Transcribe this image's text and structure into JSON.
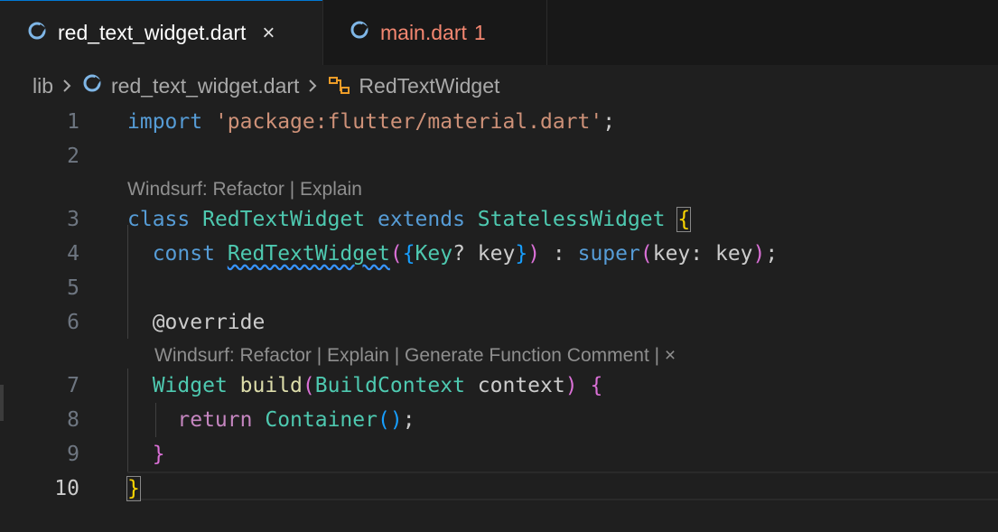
{
  "tabs": [
    {
      "label": "red_text_widget.dart",
      "icon": "dart-file-icon",
      "active": true,
      "close": "×"
    },
    {
      "label": "main.dart",
      "badge": "1",
      "icon": "dart-file-icon",
      "active": false
    }
  ],
  "breadcrumb": {
    "folder": "lib",
    "file": "red_text_widget.dart",
    "symbol": "RedTextWidget",
    "separator_icon": "chevron-right-icon",
    "symbol_icon": "class-symbol-icon"
  },
  "codelens": {
    "class_lens": "Windsurf: Refactor | Explain",
    "method_lens": "Windsurf: Refactor | Explain | Generate Function Comment | ×"
  },
  "lines": [
    {
      "num": "1",
      "tokens": [
        {
          "t": "import",
          "c": "k"
        },
        {
          "t": " "
        },
        {
          "t": "'package:flutter/material.dart'",
          "c": "s"
        },
        {
          "t": ";",
          "c": "p"
        }
      ]
    },
    {
      "num": "2",
      "tokens": []
    },
    {
      "num": "3",
      "tokens": [
        {
          "t": "class",
          "c": "k"
        },
        {
          "t": " "
        },
        {
          "t": "RedTextWidget",
          "c": "t"
        },
        {
          "t": " "
        },
        {
          "t": "extends",
          "c": "k"
        },
        {
          "t": " "
        },
        {
          "t": "StatelessWidget",
          "c": "t"
        },
        {
          "t": " "
        },
        {
          "t": "{",
          "c": "b1 bm"
        }
      ]
    },
    {
      "num": "4",
      "tokens": [
        {
          "t": "  "
        },
        {
          "t": "const",
          "c": "k"
        },
        {
          "t": " "
        },
        {
          "t": "RedTextWidget",
          "c": "t squig"
        },
        {
          "t": "(",
          "c": "b2"
        },
        {
          "t": "{",
          "c": "b3"
        },
        {
          "t": "Key",
          "c": "t"
        },
        {
          "t": "? ",
          "c": "p"
        },
        {
          "t": "key",
          "c": "p"
        },
        {
          "t": "}",
          "c": "b3"
        },
        {
          "t": ")",
          "c": "b2"
        },
        {
          "t": " : ",
          "c": "p"
        },
        {
          "t": "super",
          "c": "k"
        },
        {
          "t": "(",
          "c": "b2"
        },
        {
          "t": "key",
          "c": "p"
        },
        {
          "t": ": ",
          "c": "p"
        },
        {
          "t": "key",
          "c": "p"
        },
        {
          "t": ")",
          "c": "b2"
        },
        {
          "t": ";",
          "c": "p"
        }
      ]
    },
    {
      "num": "5",
      "tokens": []
    },
    {
      "num": "6",
      "tokens": [
        {
          "t": "  "
        },
        {
          "t": "@override",
          "c": "p"
        }
      ]
    },
    {
      "num": "7",
      "tokens": [
        {
          "t": "  "
        },
        {
          "t": "Widget",
          "c": "t"
        },
        {
          "t": " "
        },
        {
          "t": "build",
          "c": "f"
        },
        {
          "t": "(",
          "c": "b2"
        },
        {
          "t": "BuildContext",
          "c": "t"
        },
        {
          "t": " "
        },
        {
          "t": "context",
          "c": "p"
        },
        {
          "t": ")",
          "c": "b2"
        },
        {
          "t": " "
        },
        {
          "t": "{",
          "c": "b2"
        }
      ]
    },
    {
      "num": "8",
      "tokens": [
        {
          "t": "    "
        },
        {
          "t": "return",
          "c": "k2"
        },
        {
          "t": " "
        },
        {
          "t": "Container",
          "c": "t"
        },
        {
          "t": "(",
          "c": "b3"
        },
        {
          "t": ")",
          "c": "b3"
        },
        {
          "t": ";",
          "c": "p"
        }
      ]
    },
    {
      "num": "9",
      "tokens": [
        {
          "t": "  "
        },
        {
          "t": "}",
          "c": "b2"
        }
      ]
    },
    {
      "num": "10",
      "tokens": [
        {
          "t": "}",
          "c": "b1 bm"
        }
      ]
    }
  ]
}
